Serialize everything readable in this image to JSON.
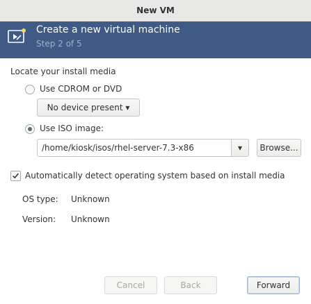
{
  "window": {
    "title": "New VM"
  },
  "banner": {
    "heading": "Create a new virtual machine",
    "step": "Step 2 of 5"
  },
  "install_media": {
    "heading": "Locate your install media",
    "cdrom_label": "Use CDROM or DVD",
    "device_dropdown": "No device present ▾",
    "iso_label": "Use ISO image:",
    "iso_path": "/home/kiosk/isos/rhel-server-7.3-x86",
    "iso_dropdown_arrow": "▾",
    "browse_label": "Browse...",
    "selected_option": "iso"
  },
  "os_detection": {
    "auto_detect_label": "Automatically detect operating system based on install media",
    "auto_detect_checked": true,
    "os_type_label": "OS type:",
    "os_type_value": "Unknown",
    "version_label": "Version:",
    "version_value": "Unknown"
  },
  "buttons": {
    "cancel": "Cancel",
    "back": "Back",
    "forward": "Forward"
  },
  "colors": {
    "banner": "#3f5a84",
    "banner_text": "#ffffff",
    "step_text": "#9fb1cc"
  }
}
